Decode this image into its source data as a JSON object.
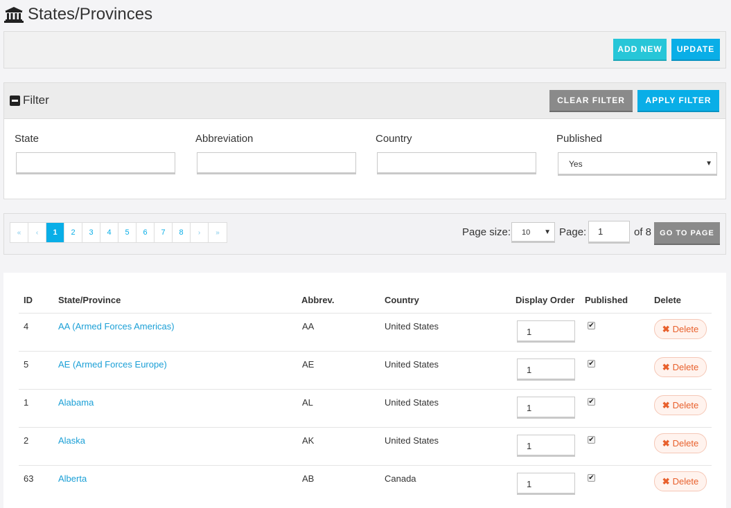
{
  "page": {
    "title": "States/Provinces"
  },
  "toolbar": {
    "add_new": "ADD NEW",
    "update": "UPDATE"
  },
  "filter": {
    "title": "Filter",
    "clear": "CLEAR FILTER",
    "apply": "APPLY FILTER",
    "fields": {
      "state": {
        "label": "State",
        "value": ""
      },
      "abbreviation": {
        "label": "Abbreviation",
        "value": ""
      },
      "country": {
        "label": "Country",
        "value": ""
      },
      "published": {
        "label": "Published",
        "value": "Yes"
      }
    }
  },
  "pagination": {
    "first": "«",
    "prev": "‹",
    "next": "›",
    "last": "»",
    "pages": [
      "1",
      "2",
      "3",
      "4",
      "5",
      "6",
      "7",
      "8"
    ],
    "current": "1",
    "page_size_label": "Page size:",
    "page_size": "10",
    "page_label": "Page:",
    "page_value": "1",
    "of_text": "of 8",
    "go_button": "GO TO PAGE"
  },
  "table": {
    "headers": {
      "id": "ID",
      "state": "State/Province",
      "abbrev": "Abbrev.",
      "country": "Country",
      "order": "Display Order",
      "published": "Published",
      "delete": "Delete"
    },
    "delete_label": "Delete",
    "rows": [
      {
        "id": "4",
        "name": "AA (Armed Forces Americas)",
        "abbrev": "AA",
        "country": "United States",
        "order": "1",
        "published": true
      },
      {
        "id": "5",
        "name": "AE (Armed Forces Europe)",
        "abbrev": "AE",
        "country": "United States",
        "order": "1",
        "published": true
      },
      {
        "id": "1",
        "name": "Alabama",
        "abbrev": "AL",
        "country": "United States",
        "order": "1",
        "published": true
      },
      {
        "id": "2",
        "name": "Alaska",
        "abbrev": "AK",
        "country": "United States",
        "order": "1",
        "published": true
      },
      {
        "id": "63",
        "name": "Alberta",
        "abbrev": "AB",
        "country": "Canada",
        "order": "1",
        "published": true
      }
    ]
  },
  "colors": {
    "accent_blue": "#09aee7",
    "teal": "#27c6d8",
    "gray_button": "#8a8a8a",
    "link": "#1a9fd6",
    "delete": "#e8602c"
  },
  "icons": {
    "title": "bank-icon",
    "filter": "minus-square-icon",
    "delete": "times-icon",
    "checkbox": "check-icon",
    "dropdown": "caret-down-icon"
  }
}
